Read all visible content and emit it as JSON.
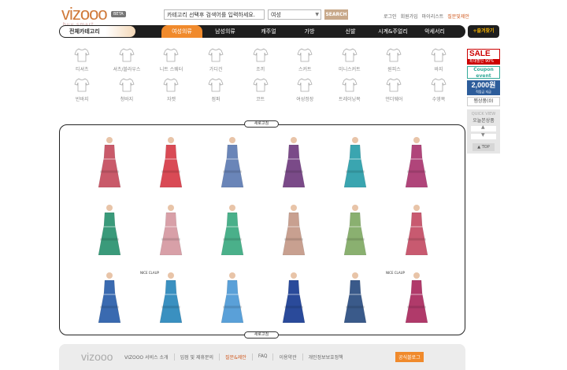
{
  "header": {
    "logo": "vizooo",
    "logo_sub": "buy smart",
    "beta": "BETA",
    "search_placeholder": "카테고리 선택후 검색어를 입력하세요.",
    "search_category": "여성",
    "search_button": "SEARCH",
    "links": [
      "로그인",
      "회원가입",
      "마이리스트",
      "질문및제안"
    ]
  },
  "nav": {
    "all_categories": "전체카테고리",
    "items": [
      "여성의류",
      "남성의류",
      "캐주얼",
      "가방",
      "신발",
      "시계&주얼리",
      "악세서리"
    ],
    "favorite": "+즐겨찾기"
  },
  "categories": [
    "티셔츠",
    "셔츠/블라우스",
    "니트 스웨터",
    "가디건",
    "조끼",
    "스커트",
    "미니스커트",
    "원피스",
    "바지",
    "반바지",
    "청바지",
    "자켓",
    "점퍼",
    "코트",
    "여성정장",
    "트레이닝복",
    "언더웨어",
    "수영복"
  ],
  "sidebar": {
    "sale": "SALE",
    "sale_sub": "최대할인 90%",
    "coupon": "Coupon event",
    "won": "2,000원",
    "won_sub": "적립금 지급",
    "cart": "찜상품(0)",
    "recent_en": "QUICK VIEW",
    "recent_ko": "오늘본상품",
    "top": "▲ TOP"
  },
  "products": {
    "tag": "새로고침",
    "colors": [
      "#c95a6a",
      "#d94a55",
      "#6a85b8",
      "#7a4a88",
      "#3aa5b0",
      "#b0457a",
      "#3a9a7a",
      "#d8a0a8",
      "#4ab08a",
      "#c8a090",
      "#8ab070",
      "#c85a70",
      "#3a6ab0",
      "#3a90c0",
      "#5aa0d8",
      "#2a4a9a",
      "#3a5a8a",
      "#b03a6a"
    ],
    "labels": [
      "",
      "",
      "",
      "",
      "",
      "",
      "",
      "",
      "",
      "",
      "",
      "",
      "",
      "NICE CLAUP",
      "",
      "",
      "",
      "NICE CLAUP"
    ]
  },
  "footer": {
    "logo": "vizooo",
    "links": [
      "VIZOOO 서비스 소개",
      "입점 및 제휴문의",
      "질문&제안",
      "FAQ",
      "이용약관",
      "개인정보보호정책"
    ],
    "blog": "공식블로그"
  }
}
